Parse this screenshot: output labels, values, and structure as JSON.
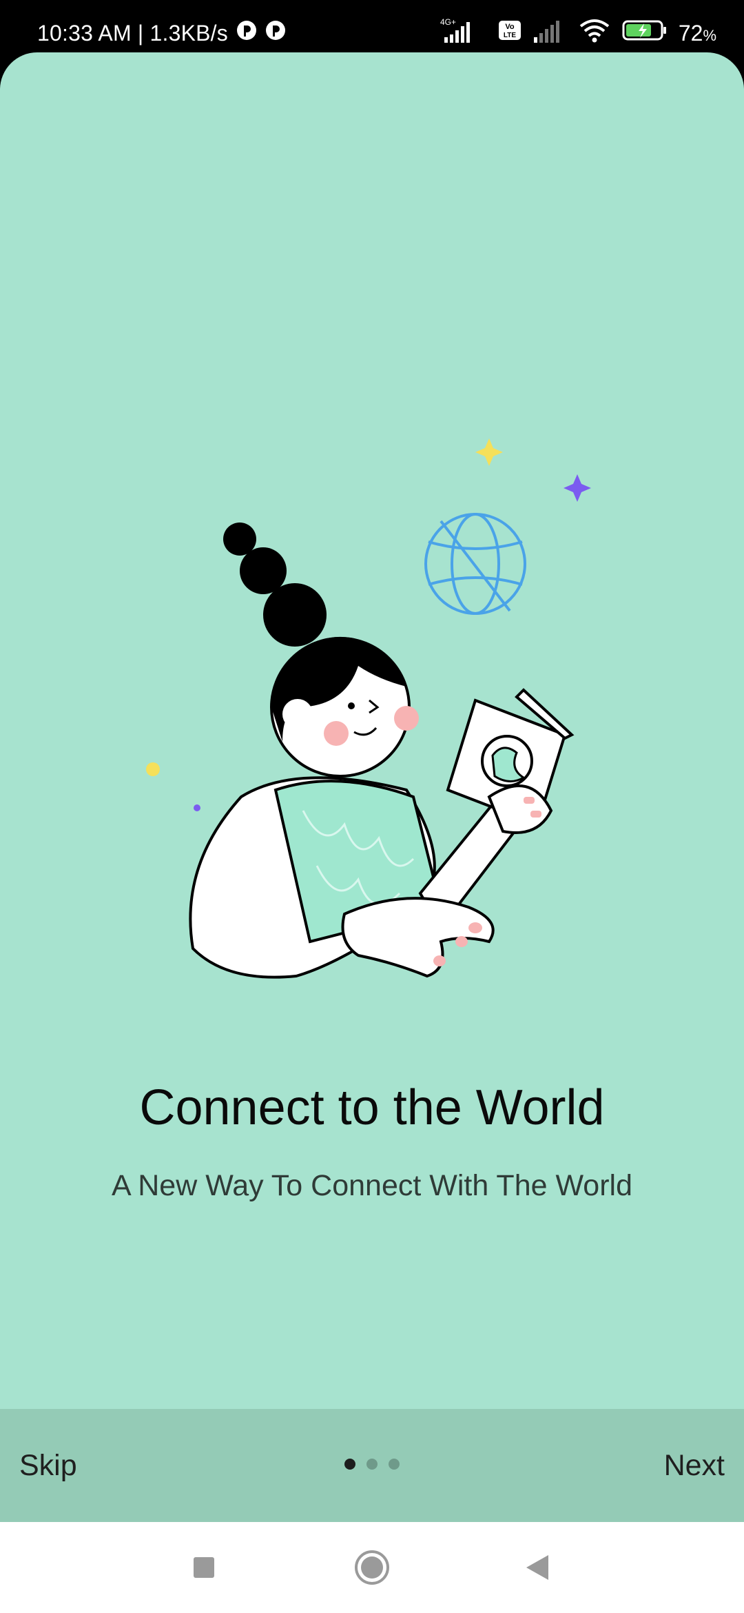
{
  "status_bar": {
    "time_speed": "10:33 AM | 1.3KB/s",
    "network_label": "4G+",
    "volte_label": "Vo LTE",
    "battery": "72",
    "battery_unit": "%",
    "icons": [
      "notification-icon",
      "notification-icon",
      "signal-icon",
      "volte-icon",
      "signal-icon",
      "wifi-icon",
      "battery-icon"
    ]
  },
  "onboarding": {
    "title": "Connect to the World",
    "subtitle": "A New Way To Connect With The World",
    "skip_label": "Skip",
    "next_label": "Next",
    "page_count": 3,
    "active_page": 1
  },
  "colors": {
    "background": "#a7e3cf",
    "bar": "#94cbb6",
    "globe": "#4aa3e8",
    "sparkle_yellow": "#f5e05a",
    "sparkle_purple": "#7b5cf0"
  },
  "system_nav": {
    "icons": [
      "recent-apps-icon",
      "home-icon",
      "back-icon"
    ]
  }
}
